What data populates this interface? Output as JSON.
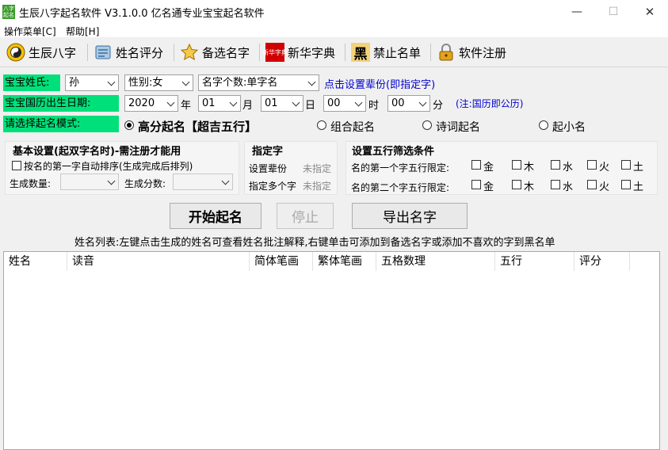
{
  "window": {
    "app_icon_text": "八字起名",
    "title": "生辰八字起名软件 V3.1.0.0   亿名通专业宝宝起名软件",
    "minimize": "—",
    "maximize": "☐",
    "close": "✕"
  },
  "menu": [
    {
      "label": "操作菜单[C]"
    },
    {
      "label": "帮助[H]"
    }
  ],
  "toolbar": [
    {
      "label": "生辰八字",
      "icon": "yinyang-icon"
    },
    {
      "label": "姓名评分",
      "icon": "scroll-icon"
    },
    {
      "label": "备选名字",
      "icon": "star-icon"
    },
    {
      "label": "新华字典",
      "icon": "dictionary-icon",
      "icon_text": "新华字典"
    },
    {
      "label": "禁止名单",
      "icon": "forbid-icon",
      "icon_text": "黑"
    },
    {
      "label": "软件注册",
      "icon": "lock-icon"
    }
  ],
  "form": {
    "surname_label": "宝宝姓氏:",
    "surname_value": "孙",
    "gender_value": "性别:女",
    "name_length_value": "名字个数:单字名",
    "set_generation_link": "点击设置辈份(即指定字)",
    "birthdate_label": "宝宝国历出生日期:",
    "year_value": "2020",
    "year_unit": "年",
    "month_value": "01",
    "month_unit": "月",
    "day_value": "01",
    "day_unit": "日",
    "hour_value": "00",
    "hour_unit": "时",
    "minute_value": "00",
    "minute_unit": "分",
    "calendar_note": "(注:国历即公历)",
    "mode_label": "请选择起名模式:",
    "modes": [
      {
        "label": "高分起名【超吉五行】",
        "selected": true
      },
      {
        "label": "组合起名",
        "selected": false
      },
      {
        "label": "诗词起名",
        "selected": false
      },
      {
        "label": "起小名",
        "selected": false
      }
    ]
  },
  "basic_settings": {
    "title": "基本设置(起双字名时)-需注册才能用",
    "auto_sort_label": "按名的第一字自动排序(生成完成后排列)",
    "count_label": "生成数量:",
    "score_label": "生成分数:"
  },
  "specify": {
    "title": "指定字",
    "generation_label": "设置辈份",
    "generation_value": "未指定",
    "multi_label": "指定多个字",
    "multi_value": "未指定"
  },
  "wuxing": {
    "title": "设置五行筛选条件",
    "row1_label": "名的第一个字五行限定:",
    "row2_label": "名的第二个字五行限定:",
    "elements": [
      "金",
      "木",
      "水",
      "火",
      "土"
    ]
  },
  "actions": {
    "start": "开始起名",
    "stop": "停止",
    "export": "导出名字"
  },
  "list": {
    "hint": "姓名列表:左键点击生成的姓名可查看姓名批注解释,右键单击可添加到备选名字或添加不喜欢的字到黑名单",
    "columns": [
      "姓名",
      "读音",
      "简体笔画",
      "繁体笔画",
      "五格数理",
      "五行",
      "评分"
    ]
  }
}
